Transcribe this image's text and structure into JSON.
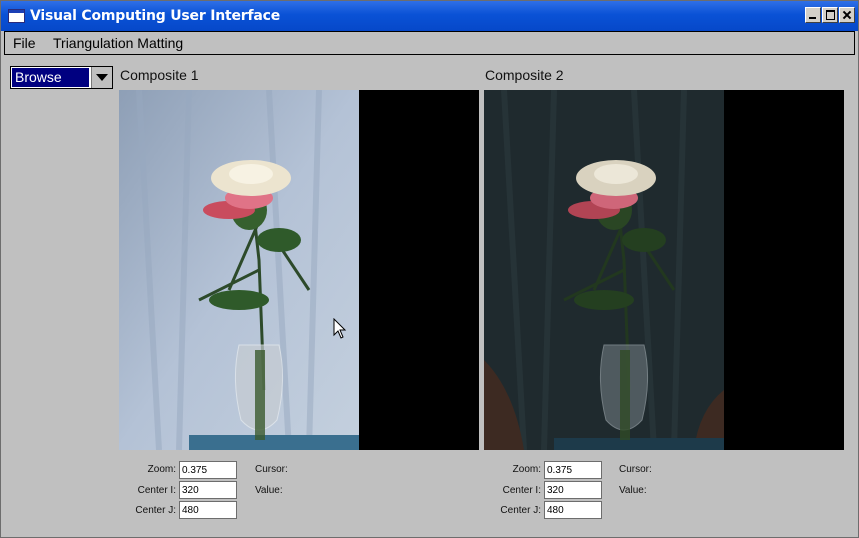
{
  "window": {
    "title": "Visual Computing User Interface"
  },
  "menu": {
    "file": "File",
    "triangulation": "Triangulation Matting"
  },
  "mode_select": {
    "value": "Browse"
  },
  "panels": [
    {
      "label": "Composite 1",
      "zoom_label": "Zoom:",
      "zoom": "0.375",
      "center_i_label": "Center I:",
      "center_i": "320",
      "center_j_label": "Center J:",
      "center_j": "480",
      "cursor_label": "Cursor:",
      "value_label": "Value:"
    },
    {
      "label": "Composite 2",
      "zoom_label": "Zoom:",
      "zoom": "0.375",
      "center_i_label": "Center I:",
      "center_i": "320",
      "center_j_label": "Center J:",
      "center_j": "480",
      "cursor_label": "Cursor:",
      "value_label": "Value:"
    }
  ],
  "colors": {
    "titlebar": "#0a52d6",
    "selection": "#000080",
    "backdrop_light": "#a9b8cc",
    "backdrop_dark": "#1f2a2e"
  }
}
